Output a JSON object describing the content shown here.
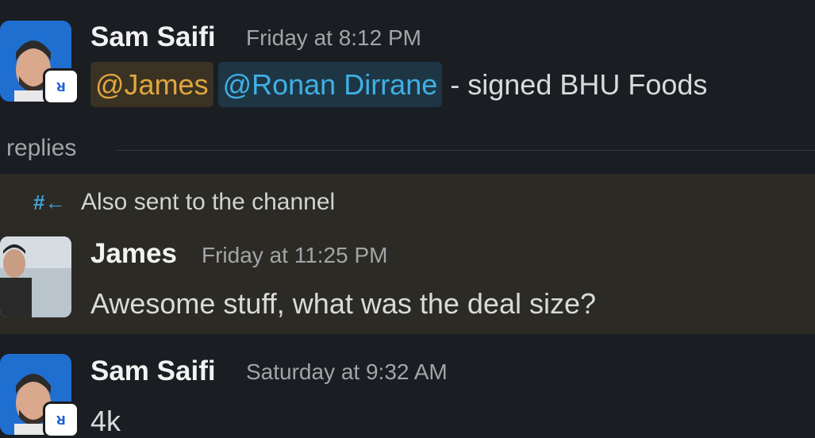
{
  "messages": [
    {
      "author": "Sam Saifi",
      "time": "Friday at 8:12 PM",
      "mentions": [
        "@James",
        "@Ronan Dirrane"
      ],
      "text": "- signed BHU Foods"
    },
    {
      "author": "James",
      "time": "Friday at 11:25 PM",
      "text": "Awesome stuff, what was the deal size?"
    },
    {
      "author": "Sam Saifi",
      "time": "Saturday at 9:32 AM",
      "text": "4k"
    }
  ],
  "divider": {
    "label": "replies"
  },
  "thread_notice": "Also sent to the channel",
  "colors": {
    "background": "#1a1d21",
    "highlight": "#2c2a25",
    "mention_yellow": "#e0a63e",
    "mention_blue": "#3fb0e6"
  },
  "icons": [
    "app-badge-icon",
    "channel-hash-arrow-icon"
  ]
}
